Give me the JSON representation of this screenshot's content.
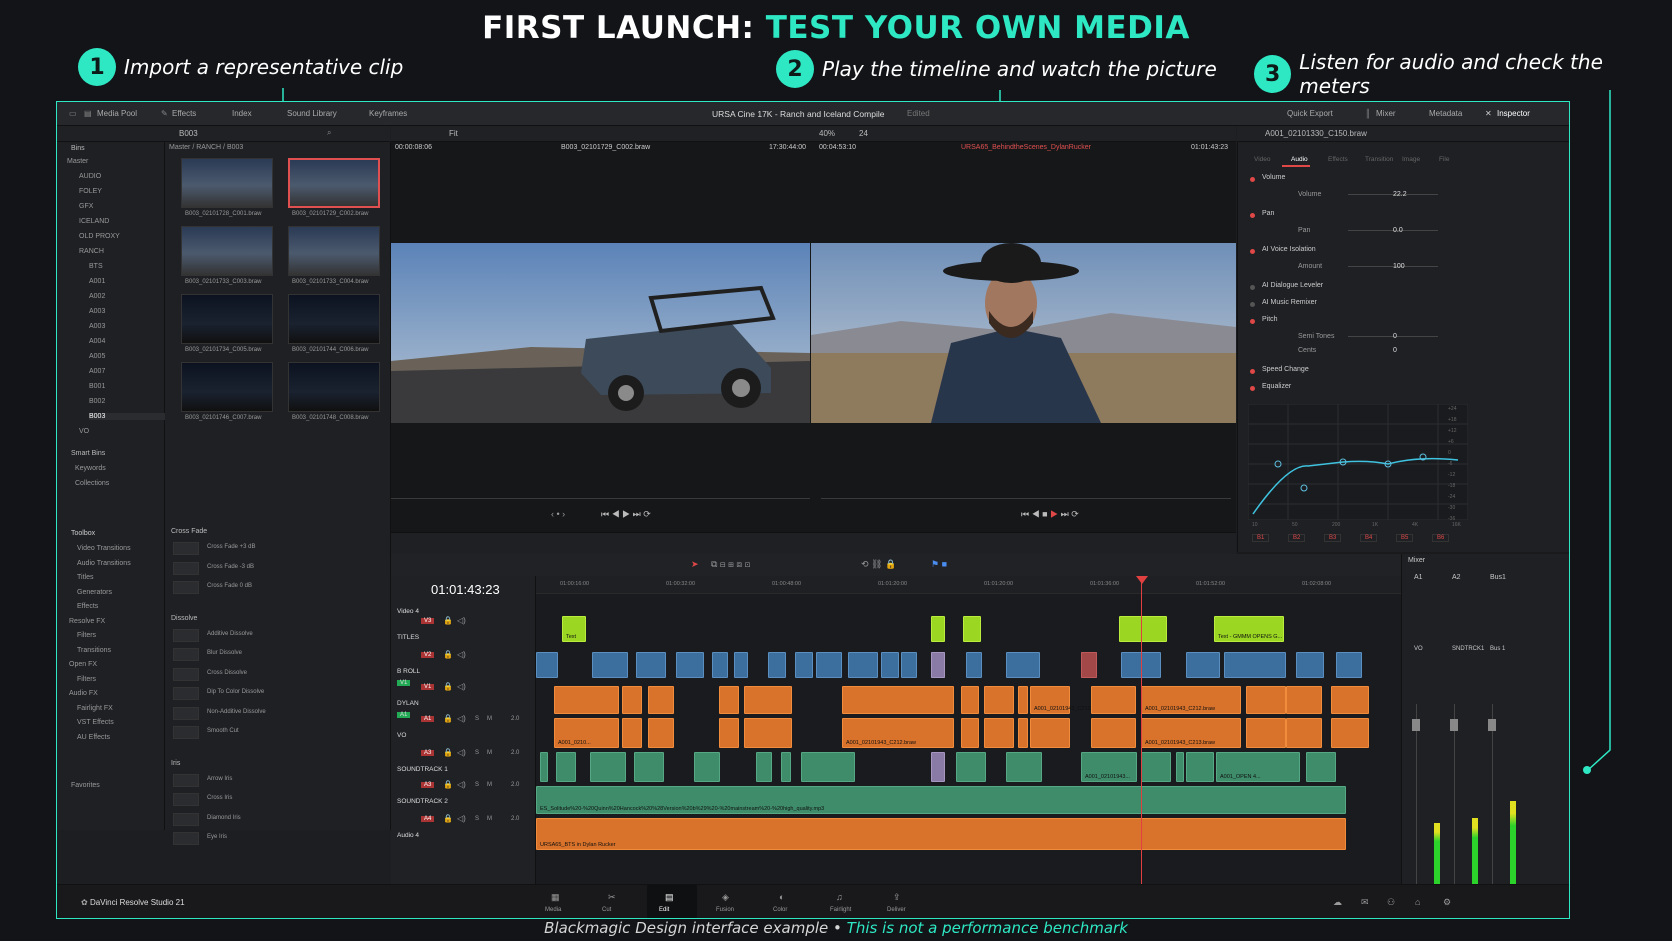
{
  "headline": {
    "prefix": "FIRST LAUNCH:",
    "accent": "TEST YOUR OWN MEDIA"
  },
  "steps": [
    {
      "num": "1",
      "text": "Import a representative clip"
    },
    {
      "num": "2",
      "text": "Play the timeline and watch the picture"
    },
    {
      "num": "3",
      "text": "Listen for audio and check the meters"
    }
  ],
  "caption": {
    "prefix": "Blackmagic Design interface example •",
    "accent": "This is not a performance benchmark"
  },
  "toolbar": {
    "media_pool": "Media Pool",
    "effects": "Effects",
    "index": "Index",
    "sound_library": "Sound Library",
    "keyframes": "Keyframes",
    "project_title": "URSA Cine 17K - Ranch and Iceland Compile",
    "edited": "Edited",
    "quick_export": "Quick Export",
    "mixer": "Mixer",
    "metadata": "Metadata",
    "inspector": "Inspector"
  },
  "media_pool": {
    "current_bin": "B003",
    "path": "Master / RANCH / B003",
    "bins_label": "Bins",
    "bins": [
      "Master",
      "AUDIO",
      "FOLEY",
      "GFX",
      "ICELAND",
      "OLD PROXY",
      "RANCH",
      "BTS",
      "A001",
      "A002",
      "A003",
      "A003",
      "A004",
      "A005",
      "A007",
      "B001",
      "B002",
      "B003",
      "VO"
    ],
    "smart_bins": "Smart Bins",
    "smart_items": [
      "Keywords",
      "Collections"
    ],
    "clips": [
      "B003_02101728_C001.braw",
      "B003_02101729_C002.braw",
      "B003_02101733_C003.braw",
      "B003_02101733_C004.braw",
      "B003_02101734_C005.braw",
      "B003_02101744_C006.braw",
      "B003_02101746_C007.braw",
      "B003_02101748_C008.braw"
    ]
  },
  "viewer": {
    "source_tc": "00:00:08:06",
    "source_clip": "B003_02101729_C002.braw",
    "source_dur": "17:30:44:00",
    "fit": "Fit",
    "zoom": "40%",
    "fps": "24",
    "program_tc_dur": "00:04:53:10",
    "program_clip": "URSA65_BehindtheScenes_DylanRucker",
    "program_tc": "01:01:43:23"
  },
  "inspector": {
    "clip": "A001_02101330_C150.braw",
    "tabs": [
      "Video",
      "Audio",
      "Effects",
      "Transition",
      "Image",
      "File"
    ],
    "sections": [
      {
        "name": "Volume",
        "param": "Volume",
        "value": "22.2"
      },
      {
        "name": "Pan",
        "param": "Pan",
        "value": "0.0"
      },
      {
        "name": "AI Voice Isolation",
        "param": "Amount",
        "value": "100"
      },
      {
        "name": "AI Dialogue Leveler"
      },
      {
        "name": "AI Music Remixer"
      },
      {
        "name": "Pitch",
        "param": "Semi Tones",
        "value": "0",
        "param2": "Cents",
        "value2": "0"
      },
      {
        "name": "Speed Change"
      },
      {
        "name": "Equalizer"
      }
    ],
    "eq_bands": [
      "B1",
      "B2",
      "B3",
      "B4",
      "B5",
      "B6"
    ],
    "eq_freqs": [
      "10",
      "50",
      "200",
      "1K",
      "4K",
      "16K"
    ],
    "eq_db": [
      "+24",
      "+18",
      "+12",
      "+6",
      "0",
      "-6",
      "-12",
      "-18",
      "-24",
      "-30",
      "-36"
    ]
  },
  "effects": {
    "toolbox": "Toolbox",
    "tree": [
      "Video Transitions",
      "Audio Transitions",
      "Titles",
      "Generators",
      "Effects",
      "Resolve FX",
      "Filters",
      "Transitions",
      "Open FX",
      "Filters",
      "Audio FX",
      "Fairlight FX",
      "VST Effects",
      "AU Effects"
    ],
    "favorites": "Favorites",
    "groups": [
      {
        "name": "Cross Fade",
        "items": [
          "Cross Fade +3 dB",
          "Cross Fade -3 dB",
          "Cross Fade 0 dB"
        ]
      },
      {
        "name": "Dissolve",
        "items": [
          "Additive Dissolve",
          "Blur Dissolve",
          "Cross Dissolve",
          "Dip To Color Dissolve",
          "Non-Additive Dissolve",
          "Smooth Cut"
        ]
      },
      {
        "name": "Iris",
        "items": [
          "Arrow Iris",
          "Cross Iris",
          "Diamond Iris",
          "Eye Iris"
        ]
      }
    ]
  },
  "timeline": {
    "timecode": "01:01:43:23",
    "ruler": [
      "01:00:16:00",
      "01:00:32:00",
      "01:00:48:00",
      "01:01:20:00",
      "01:01:20:00",
      "01:01:36:00",
      "01:01:52:00",
      "01:02:08:00"
    ],
    "tracks": [
      {
        "id": "V3",
        "name": "Video 4"
      },
      {
        "id": "V3",
        "name": "TITLES"
      },
      {
        "id": "V2",
        "name": "B ROLL"
      },
      {
        "id": "V1",
        "name": "DYLAN"
      },
      {
        "id": "A1",
        "name": "VO"
      },
      {
        "id": "A3",
        "name": "SOUNDTRACK 1"
      },
      {
        "id": "A3",
        "name": "SOUNDTRACK 2"
      },
      {
        "id": "A4",
        "name": "Audio 4"
      }
    ],
    "track_source": [
      "V1",
      "A1"
    ],
    "track_dest": [
      "V1",
      "VO"
    ],
    "level": "2.0",
    "title_clips": [
      "Text",
      "Text - GMMM OPENS G..."
    ],
    "dylan_clips": [
      "A001_02101943_C213.braw",
      "A001_02101943_C212.braw",
      "A001_02101943_C212.braw"
    ],
    "vo_clips": [
      "A001_0210...",
      "A001_02101943_C212.braw",
      "A001_02101943_C213.braw"
    ],
    "st1_clips": [
      "A001_02101943...",
      "A001_02101942_C...",
      "A001_OPEN 4..."
    ],
    "st2_clip": "ES_Solitude%20-%20Quinn%20Hancock%20%28Version%20b%29%20-%20mainstream%20-%20high_quality.mp3",
    "audio4_clip": "URSA65_BTS in Dylan Rucker"
  },
  "mixer": {
    "title": "Mixer",
    "channels": [
      "A1",
      "A2",
      "Bus1"
    ],
    "names": [
      "VO",
      "SNDTRCK1",
      "Bus 1"
    ],
    "levels": [
      0.55,
      0.6,
      0.75
    ]
  },
  "pages": [
    "Media",
    "Cut",
    "Edit",
    "Fusion",
    "Color",
    "Fairlight",
    "Deliver"
  ],
  "pages_sub": [
    "Media",
    "Cut",
    "Edit",
    "Fusion",
    "Color",
    "Fairlight",
    "Deliver"
  ],
  "app_name": "DaVinci Resolve Studio 21"
}
